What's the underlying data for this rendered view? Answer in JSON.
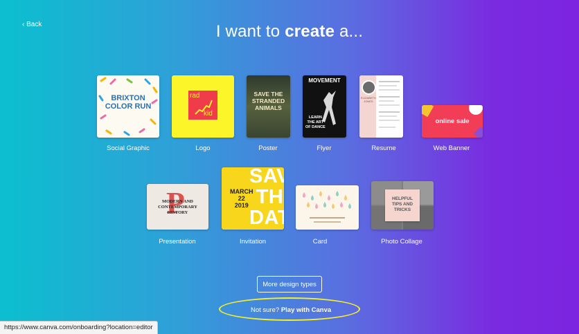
{
  "back_label": "‹ Back",
  "title": {
    "prefix": "I want to ",
    "bold": "create",
    "suffix": " a..."
  },
  "row1": [
    {
      "label": "Social Graphic",
      "thumb_text": [
        "BRIXTON",
        "COLOR RUN"
      ]
    },
    {
      "label": "Logo",
      "thumb_text": [
        "rad",
        "kid"
      ]
    },
    {
      "label": "Poster",
      "thumb_text": [
        "SAVE THE",
        "STRANDED",
        "ANIMALS"
      ]
    },
    {
      "label": "Flyer",
      "thumb_text": [
        "MOVEMENT",
        "LEARN",
        "THE ART",
        "OF DANCE"
      ]
    },
    {
      "label": "Resume",
      "thumb_text": [
        "ELIZABETH",
        "JONES"
      ]
    },
    {
      "label": "Web Banner",
      "thumb_text": [
        "online sale"
      ]
    }
  ],
  "row2": [
    {
      "label": "Presentation",
      "thumb_text": [
        "MODERN AND",
        "CONTEMPORARY",
        "HISTORY"
      ]
    },
    {
      "label": "Invitation",
      "thumb_text": [
        "MARCH",
        "22",
        "2019",
        "SAVE",
        "THE",
        "DATE"
      ]
    },
    {
      "label": "Card",
      "thumb_text": []
    },
    {
      "label": "Photo Collage",
      "thumb_text": [
        "HELPFUL",
        "TIPS AND",
        "TRICKS"
      ]
    }
  ],
  "more_button": "More design types",
  "not_sure": {
    "prefix": "Not sure? ",
    "link": "Play with Canva"
  },
  "status_url": "https://www.canva.com/onboarding?location=editor",
  "colors": {
    "gradient_start": "#0bbfcf",
    "gradient_end": "#7c24e0",
    "highlight": "#f6ef2b"
  }
}
